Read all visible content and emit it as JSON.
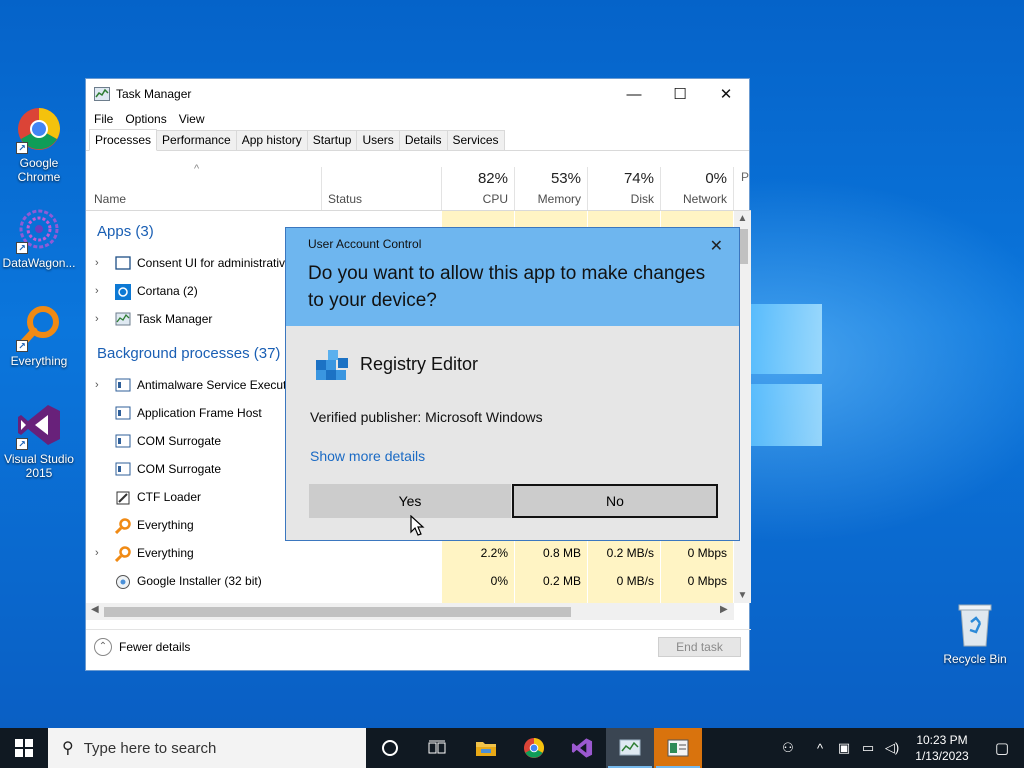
{
  "desktop": {
    "icons": [
      {
        "label": "Google Chrome",
        "icon": "chrome-icon"
      },
      {
        "label": "DataWagon...",
        "icon": "datawagon-icon"
      },
      {
        "label": "Everything",
        "icon": "everything-icon"
      },
      {
        "label": "Visual Studio 2015",
        "icon": "visual-studio-icon"
      },
      {
        "label": "Recycle Bin",
        "icon": "recycle-bin-icon"
      }
    ]
  },
  "task_manager": {
    "title": "Task Manager",
    "caption_buttons": {
      "minimize": "—",
      "maximize": "☐",
      "close": "✕"
    },
    "menu": [
      "File",
      "Options",
      "View"
    ],
    "tabs": [
      "Processes",
      "Performance",
      "App history",
      "Startup",
      "Users",
      "Details",
      "Services"
    ],
    "active_tab": "Processes",
    "columns": {
      "name": "Name",
      "status": "Status",
      "cpu": {
        "label": "CPU",
        "pct": "82%"
      },
      "memory": {
        "label": "Memory",
        "pct": "53%"
      },
      "disk": {
        "label": "Disk",
        "pct": "74%"
      },
      "network": {
        "label": "Network",
        "pct": "0%"
      },
      "power_partial": "P"
    },
    "groups": {
      "apps": "Apps (3)",
      "background": "Background processes (37)"
    },
    "rows": [
      {
        "name": "Consent UI for administrative applications",
        "expand": true,
        "icon": "window-icon"
      },
      {
        "name": "Cortana (2)",
        "expand": true,
        "icon": "cortana-icon"
      },
      {
        "name": "Task Manager",
        "expand": true,
        "icon": "task-manager-icon"
      },
      {
        "name": "Antimalware Service Executable",
        "expand": true,
        "icon": "service-icon"
      },
      {
        "name": "Application Frame Host",
        "expand": false,
        "icon": "service-icon"
      },
      {
        "name": "COM Surrogate",
        "expand": false,
        "icon": "service-icon"
      },
      {
        "name": "COM Surrogate",
        "expand": false,
        "icon": "service-icon"
      },
      {
        "name": "CTF Loader",
        "expand": false,
        "icon": "ctf-icon"
      },
      {
        "name": "Everything",
        "expand": false,
        "icon": "everything-icon"
      },
      {
        "name": "Everything",
        "expand": true,
        "icon": "everything-icon",
        "cpu": "2.2%",
        "memory": "0.8 MB",
        "disk": "0.2 MB/s",
        "network": "0 Mbps"
      },
      {
        "name": "Google Installer (32 bit)",
        "expand": false,
        "icon": "installer-icon",
        "cpu": "0%",
        "memory": "0.2 MB",
        "disk": "0 MB/s",
        "network": "0 Mbps"
      }
    ],
    "footer": {
      "fewer_details": "Fewer details",
      "end_task": "End task"
    }
  },
  "uac": {
    "window_label": "User Account Control",
    "question": "Do you want to allow this app to make changes to your device?",
    "app_name": "Registry Editor",
    "publisher": "Verified publisher: Microsoft Windows",
    "show_more": "Show more details",
    "yes": "Yes",
    "no": "No"
  },
  "taskbar": {
    "search_placeholder": "Type here to search",
    "pinned": [
      "task-view-icon",
      "cortana-circle-icon",
      "file-explorer-icon",
      "chrome-icon",
      "visual-studio-icon",
      "task-manager-icon",
      "registry-app-icon"
    ],
    "clock_time": "10:23 PM",
    "clock_date": "1/13/2023"
  },
  "colors": {
    "accent": "#6eb6ef",
    "link": "#1a6ac4",
    "heat": "#fff4c4",
    "taskbar": "#101922"
  }
}
